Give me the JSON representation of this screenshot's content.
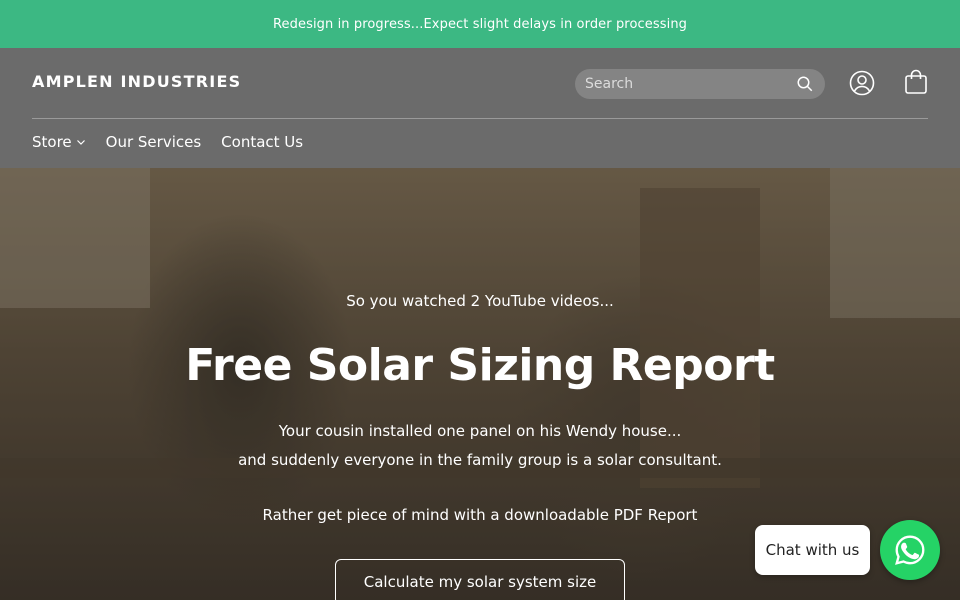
{
  "announcement": {
    "text": "Redesign in progress...Expect slight delays in order processing"
  },
  "header": {
    "brand": "AMPLEN INDUSTRIES",
    "search_placeholder": "Search",
    "nav": [
      {
        "label": "Store",
        "has_dropdown": true
      },
      {
        "label": "Our Services"
      },
      {
        "label": "Contact Us"
      }
    ]
  },
  "hero": {
    "eyebrow": "So you watched 2 YouTube videos...",
    "headline": "Free Solar Sizing Report",
    "line1": "Your cousin installed one panel on his Wendy house...",
    "line2": "and suddenly everyone in the family group is a solar consultant.",
    "line3": "Rather get piece of mind with a downloadable PDF Report",
    "cta_label": "Calculate my solar system size"
  },
  "chat": {
    "label": "Chat with us",
    "icon": "whatsapp-icon"
  },
  "colors": {
    "announcement_bg": "#3cb883",
    "header_bg": "#6b6b6b",
    "whatsapp": "#25d366"
  },
  "icons": {
    "search": "search-icon",
    "account": "account-icon",
    "cart": "shopping-bag-icon",
    "dropdown": "chevron-down-icon"
  }
}
